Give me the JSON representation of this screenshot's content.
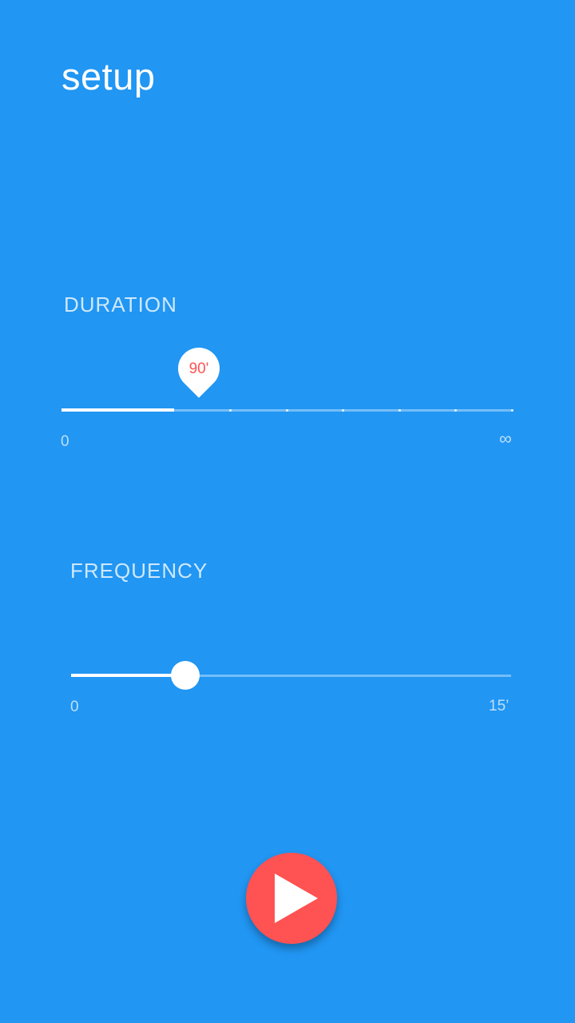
{
  "header": {
    "title": "setup"
  },
  "duration": {
    "label": "DURATION",
    "value_label": "90'",
    "min_label": "0",
    "max_label": "∞",
    "step_count": 8,
    "current_step": 2
  },
  "frequency": {
    "label": "FREQUENCY",
    "min_label": "0",
    "max_label": "15’",
    "value_fraction": 0.26
  },
  "play": {
    "icon": "play-icon",
    "color": "#FF5252"
  },
  "colors": {
    "background": "#2196F3",
    "accent": "#FF5252"
  }
}
